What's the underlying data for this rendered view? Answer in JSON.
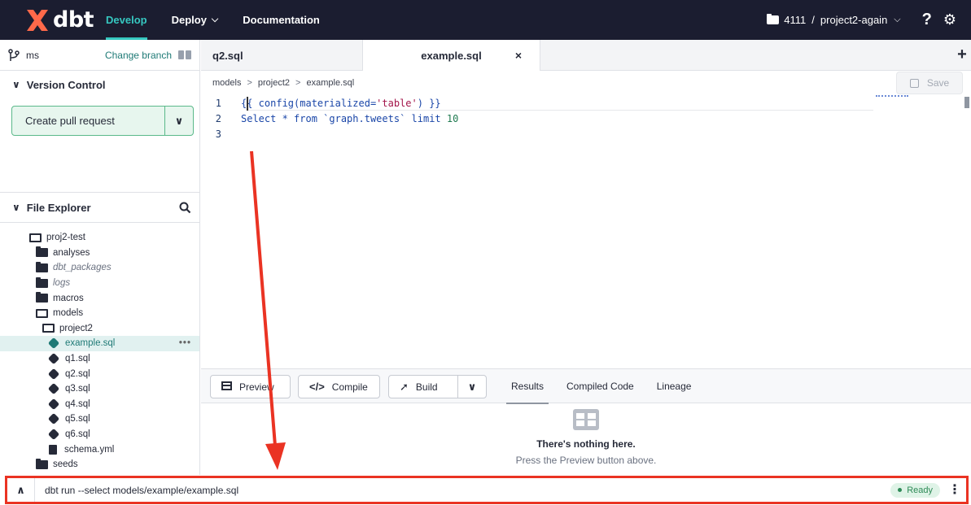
{
  "nav": {
    "brand": "dbt",
    "items": [
      {
        "label": "Develop"
      },
      {
        "label": "Deploy"
      },
      {
        "label": "Documentation"
      }
    ],
    "project_id": "4111",
    "project_sep": "/",
    "project_name": "project2-again",
    "help_icon": "?",
    "settings_icon": "gear-icon"
  },
  "sidebar": {
    "branch": "ms",
    "change_branch": "Change branch",
    "version_control": "Version Control",
    "create_pr": "Create pull request",
    "file_explorer": "File Explorer",
    "tree": [
      {
        "label": "proj2-test",
        "type": "open",
        "indent": 0
      },
      {
        "label": "analyses",
        "type": "folder",
        "indent": 1
      },
      {
        "label": "dbt_packages",
        "type": "folder",
        "indent": 1,
        "italic": true
      },
      {
        "label": "logs",
        "type": "folder",
        "indent": 1,
        "italic": true
      },
      {
        "label": "macros",
        "type": "folder",
        "indent": 1
      },
      {
        "label": "models",
        "type": "open",
        "indent": 1
      },
      {
        "label": "project2",
        "type": "open",
        "indent": 2
      },
      {
        "label": "example.sql",
        "type": "model",
        "indent": 3,
        "selected": true
      },
      {
        "label": "q1.sql",
        "type": "model",
        "indent": 3
      },
      {
        "label": "q2.sql",
        "type": "model",
        "indent": 3
      },
      {
        "label": "q3.sql",
        "type": "model",
        "indent": 3
      },
      {
        "label": "q4.sql",
        "type": "model",
        "indent": 3
      },
      {
        "label": "q5.sql",
        "type": "model",
        "indent": 3
      },
      {
        "label": "q6.sql",
        "type": "model",
        "indent": 3
      },
      {
        "label": "schema.yml",
        "type": "doc",
        "indent": 3
      },
      {
        "label": "seeds",
        "type": "folder",
        "indent": 1
      }
    ]
  },
  "editor": {
    "tabs": [
      {
        "label": "q2.sql"
      },
      {
        "label": "example.sql",
        "close": "×"
      }
    ],
    "breadcrumb": [
      "models",
      "project2",
      "example.sql"
    ],
    "save": "Save",
    "lines": [
      {
        "n": "1",
        "pre": "{{ config(materialized=",
        "str": "'table'",
        "post": ") }}"
      },
      {
        "n": "2",
        "pre": "Select * from `graph.tweets` limit ",
        "num": "10"
      },
      {
        "n": "3",
        "pre": ""
      }
    ]
  },
  "panel": {
    "preview": "Preview",
    "compile": "Compile",
    "build": "Build",
    "tabs": [
      "Results",
      "Compiled Code",
      "Lineage"
    ],
    "empty_title": "There's nothing here.",
    "empty_sub": "Press the Preview button above."
  },
  "cmdbar": {
    "command": "dbt run --select models/example/example.sql",
    "status": "Ready"
  },
  "colors": {
    "nav_bg": "#1b1d30",
    "accent": "#36c7c0",
    "annotation": "#ea3323"
  }
}
